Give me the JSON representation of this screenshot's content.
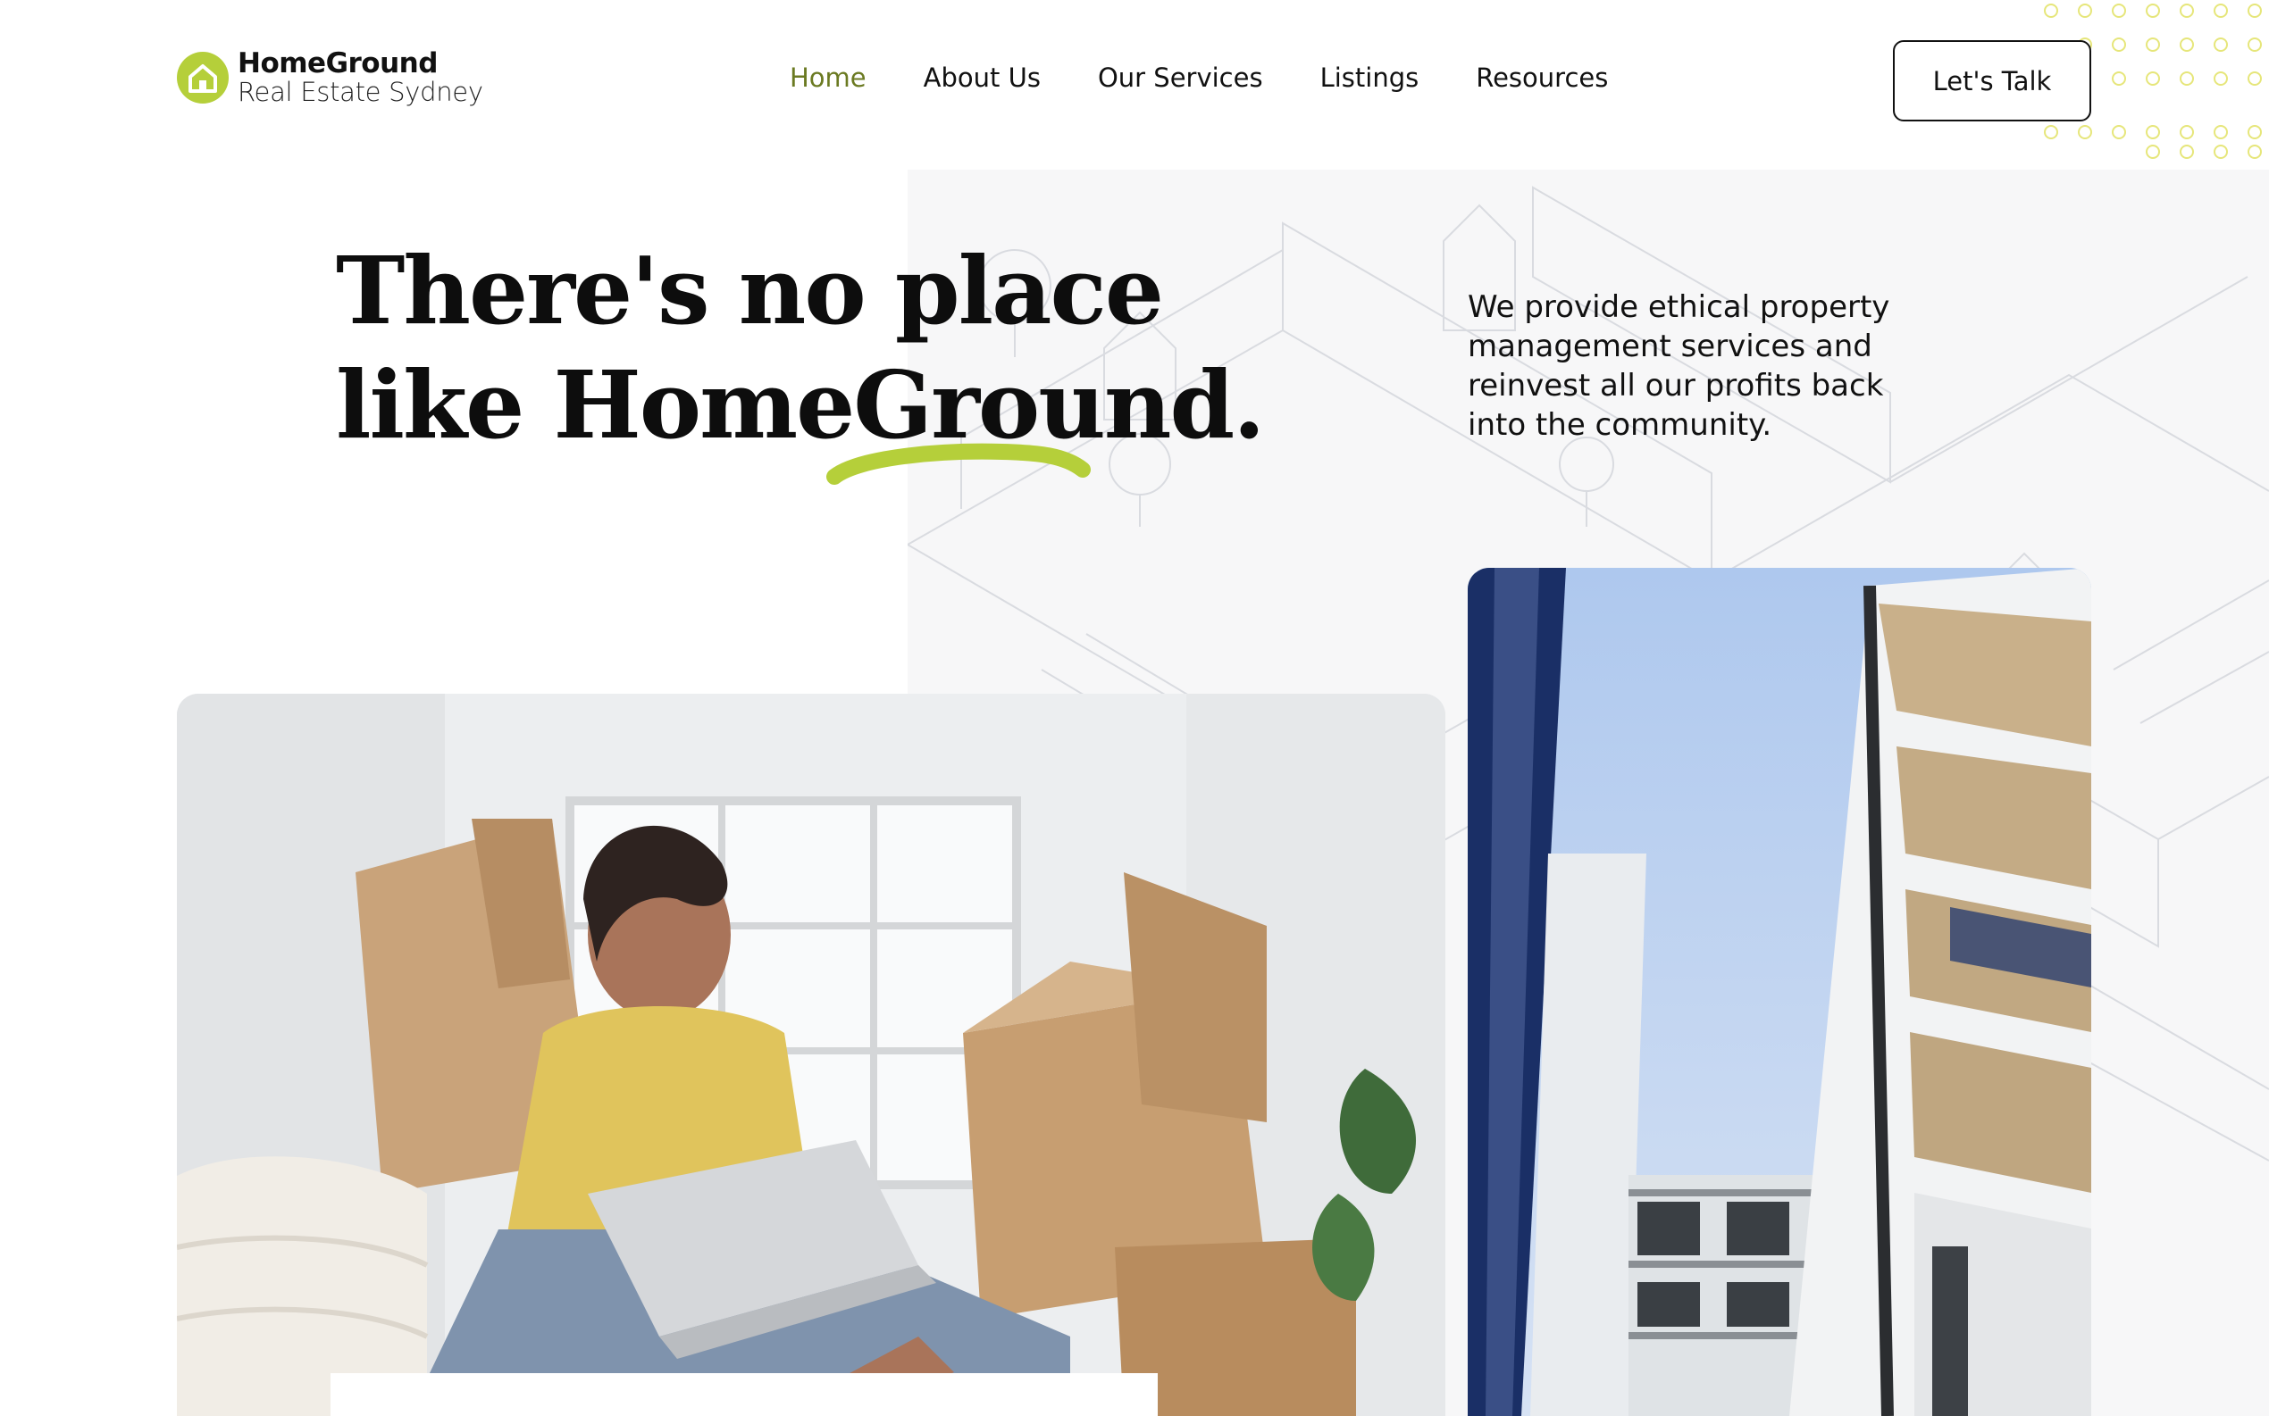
{
  "header": {
    "logo": {
      "name": "HomeGround",
      "subtitle": "Real Estate Sydney",
      "icon": "house-icon"
    },
    "nav": {
      "items": [
        {
          "label": "Home",
          "active": true
        },
        {
          "label": "About Us",
          "active": false
        },
        {
          "label": "Our Services",
          "active": false
        },
        {
          "label": "Listings",
          "active": false
        },
        {
          "label": "Resources",
          "active": false
        }
      ]
    },
    "cta_label": "Let's Talk"
  },
  "hero": {
    "title_line1": "There's no place",
    "title_line2": "like HomeGround.",
    "description": "We provide ethical property management services and reinvest all our profits back into the community."
  },
  "images": {
    "left_photo": "woman-with-laptop-among-moving-boxes",
    "right_photo": "modern-apartment-building-against-sky"
  },
  "colors": {
    "accent_green": "#b5cf3a",
    "active_nav": "#6b7a22",
    "text": "#111111",
    "dot_pattern": "#e3e36a"
  }
}
